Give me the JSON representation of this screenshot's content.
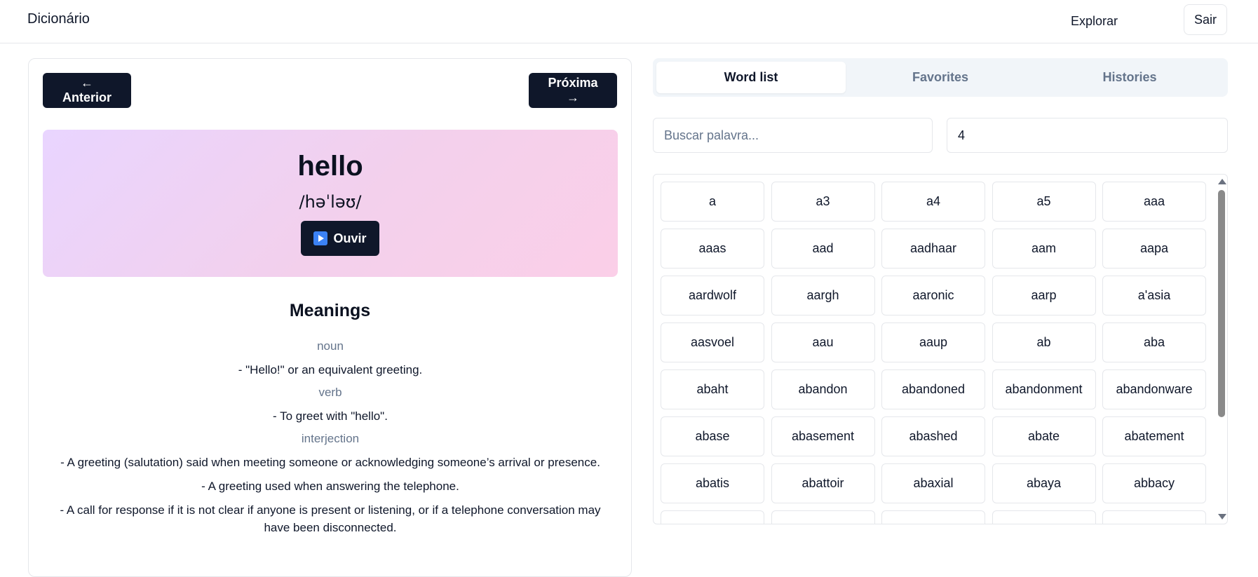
{
  "header": {
    "brand": "Dicionário",
    "explore_label": "Explorar",
    "logout_label": "Sair"
  },
  "word_view": {
    "prev_label": "← Anterior",
    "next_label": "Próxima →",
    "word": "hello",
    "phonetic": "/həˈləʊ/",
    "listen_label": "Ouvir",
    "meanings_title": "Meanings",
    "meanings": [
      {
        "part_of_speech": "noun",
        "definitions": [
          "- \"Hello!\" or an equivalent greeting."
        ]
      },
      {
        "part_of_speech": "verb",
        "definitions": [
          "- To greet with \"hello\"."
        ]
      },
      {
        "part_of_speech": "interjection",
        "definitions": [
          "- A greeting (salutation) said when meeting someone or acknowledging someone’s arrival or presence.",
          "- A greeting used when answering the telephone.",
          "- A call for response if it is not clear if anyone is present or listening, or if a telephone conversation may have been disconnected."
        ]
      }
    ]
  },
  "tabs": [
    {
      "label": "Word list",
      "active": true
    },
    {
      "label": "Favorites",
      "active": false
    },
    {
      "label": "Histories",
      "active": false
    }
  ],
  "search": {
    "placeholder": "Buscar palavra...",
    "value": ""
  },
  "limit": {
    "value": "4"
  },
  "word_list": [
    "a",
    "a3",
    "a4",
    "a5",
    "aaa",
    "aaas",
    "aad",
    "aadhaar",
    "aam",
    "aapa",
    "aardwolf",
    "aargh",
    "aaronic",
    "aarp",
    "a'asia",
    "aasvoel",
    "aau",
    "aaup",
    "ab",
    "aba",
    "abaht",
    "abandon",
    "abandoned",
    "abandonment",
    "abandonware",
    "abase",
    "abasement",
    "abashed",
    "abate",
    "abatement",
    "abatis",
    "abattoir",
    "abaxial",
    "abaya",
    "abbacy"
  ],
  "colors": {
    "primary_dark": "#0f172a",
    "muted_text": "#64748b",
    "hero_gradient_start": "#e9d5ff",
    "hero_gradient_end": "#fbcfe8"
  }
}
